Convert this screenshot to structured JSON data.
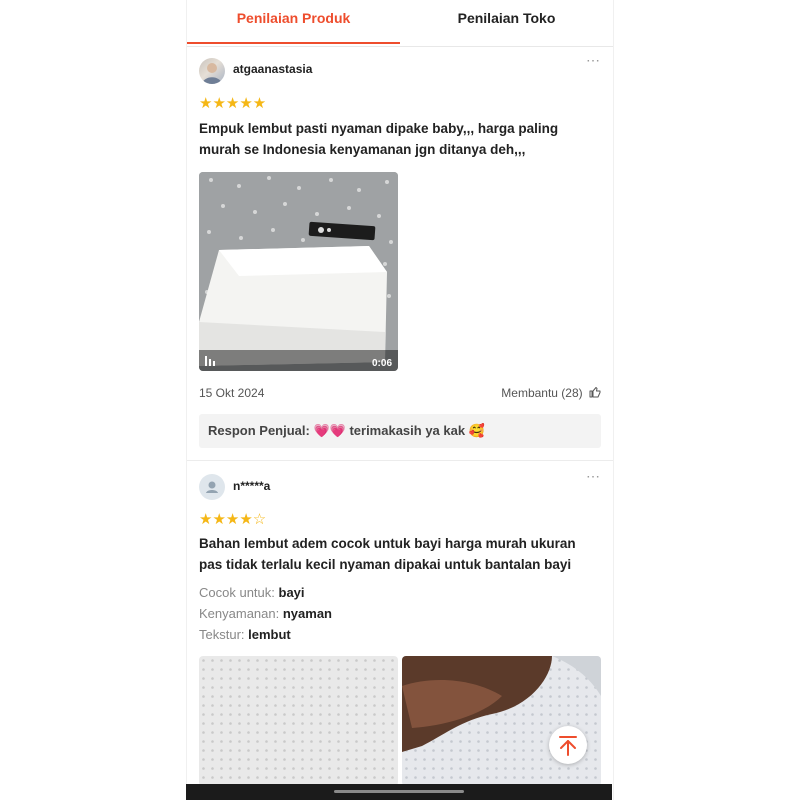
{
  "tabs": [
    {
      "label": "Penilaian Produk",
      "active": true
    },
    {
      "label": "Penilaian Toko",
      "active": false
    }
  ],
  "reviews": [
    {
      "username": "atgaanastasia",
      "rating": 5,
      "stars": "★★★★★",
      "text": "Empuk lembut pasti nyaman dipake baby,,, harga paling murah se Indonesia kenyamanan jgn ditanya deh,,,",
      "video_duration": "0:06",
      "date": "15 Okt 2024",
      "helpful_label": "Membantu (28)",
      "seller_response": "Respon Penjual: 💗💗 terimakasih ya kak 🥰"
    },
    {
      "username": "n*****a",
      "rating": 4,
      "stars_filled": "★★★★",
      "stars_empty": "☆",
      "text": "Bahan lembut adem cocok untuk bayi harga murah ukuran pas tidak terlalu kecil nyaman dipakai untuk bantalan bayi",
      "attributes": [
        {
          "label": "Cocok untuk:",
          "value": "bayi"
        },
        {
          "label": "Kenyamanan:",
          "value": "nyaman"
        },
        {
          "label": "Tekstur:",
          "value": "lembut"
        }
      ]
    }
  ],
  "icons": {
    "more": "⋯",
    "thumbs_up": "👍",
    "back_to_top": "arrow-up-to-top"
  },
  "colors": {
    "accent": "#ee4d2d",
    "star": "#f5b716"
  }
}
